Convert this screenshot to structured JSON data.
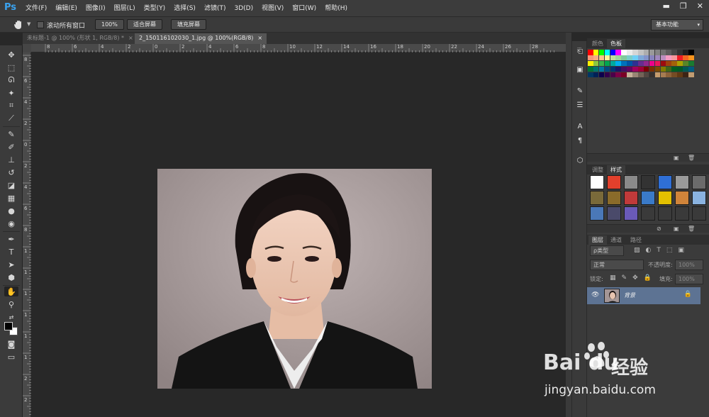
{
  "app": {
    "logo": "Ps"
  },
  "menu": [
    "文件(F)",
    "编辑(E)",
    "图像(I)",
    "图层(L)",
    "类型(Y)",
    "选择(S)",
    "滤镜(T)",
    "3D(D)",
    "视图(V)",
    "窗口(W)",
    "帮助(H)"
  ],
  "window_controls": {
    "minimize": "▬",
    "maximize": "❐",
    "close": "✕"
  },
  "options_bar": {
    "scroll_all_label": "滚动所有窗口",
    "btn_100": "100%",
    "btn_fit": "适合屏幕",
    "btn_fill": "填充屏幕",
    "workspace": "基本功能"
  },
  "tabs": [
    {
      "label": "未标题-1 @ 100% (形状 1, RGB/8) *",
      "close": "×"
    },
    {
      "label": "2_150116102030_1.jpg @ 100%(RGB/8)",
      "close": "×"
    }
  ],
  "ruler_top": [
    "8",
    "6",
    "4",
    "2",
    "0",
    "2",
    "4",
    "6",
    "8",
    "10",
    "12",
    "14",
    "16",
    "18",
    "20",
    "22",
    "24",
    "26",
    "28"
  ],
  "ruler_left": [
    "8",
    "6",
    "4",
    "2",
    "0",
    "2",
    "4",
    "6",
    "8",
    "1",
    "1",
    "1",
    "1",
    "1",
    "1",
    "2",
    "2"
  ],
  "panels": {
    "color_tabs": [
      "颜色",
      "色板"
    ],
    "adjust_tabs": [
      "调整",
      "样式"
    ],
    "layer_tabs": [
      "图层",
      "通道",
      "路径"
    ],
    "layer_filter": "ρ类型",
    "blend_mode": "正常",
    "opacity_label": "不透明度:",
    "opacity_value": "100%",
    "lock_label": "锁定:",
    "fill_label": "填充:",
    "fill_value": "100%",
    "layer_name": "背景"
  },
  "colors": {
    "swatches": [
      "#ff0000",
      "#ffff00",
      "#00ff00",
      "#00ffff",
      "#0000ff",
      "#ff00ff",
      "#ffffff",
      "#ebebeb",
      "#d6d6d6",
      "#c2c2c2",
      "#adadad",
      "#999999",
      "#858585",
      "#707070",
      "#5c5c5c",
      "#474747",
      "#333333",
      "#1f1f1f",
      "#000000",
      "#f7977a",
      "#f9ad81",
      "#fdc68a",
      "#fff79a",
      "#c4df9b",
      "#a3d39c",
      "#82ca9d",
      "#7bcdc8",
      "#6ecff6",
      "#7ea7d8",
      "#8493ca",
      "#8882be",
      "#a187be",
      "#bc8dbf",
      "#f49ac2",
      "#f6989d",
      "#ed1c24",
      "#f26522",
      "#f7941d",
      "#fff200",
      "#8dc73f",
      "#39b54a",
      "#00a651",
      "#00a99d",
      "#00aeef",
      "#0072bc",
      "#0054a6",
      "#2e3192",
      "#662d91",
      "#92278f",
      "#ec008c",
      "#ed145b",
      "#9e0b0f",
      "#a0410d",
      "#a3620a",
      "#aba000",
      "#598527",
      "#197b30",
      "#007236",
      "#00746b",
      "#0076a3",
      "#004a80",
      "#003471",
      "#1b1464",
      "#440e62",
      "#630460",
      "#9e005d",
      "#9e0039",
      "#790000",
      "#7b2e00",
      "#7d4900",
      "#827b00",
      "#406618",
      "#005e20",
      "#005826",
      "#005952",
      "#005b7f",
      "#003663",
      "#002157",
      "#0d004c",
      "#32004b",
      "#4b0049",
      "#7b0046",
      "#7a0026",
      "#c7b299",
      "#998675",
      "#736357",
      "#534741",
      "#37302d",
      "#c69c6d",
      "#a67c52",
      "#8c6239",
      "#754c24",
      "#603913",
      "#3c2415",
      "#c09c72"
    ],
    "styles": [
      "#ffffff",
      "#e2402c",
      "#8a8a8a",
      "#333333",
      "#2f6fd6",
      "#9a9a9a",
      "#6b6b6b",
      "#7a6a3a",
      "#8a6b2a",
      "#c03a3a",
      "#3a7ac8",
      "#e3c000",
      "#d0843a",
      "#8ab3e0",
      "#4a78b8",
      "#4a4a6a",
      "#6a5ab8",
      "#3a3a3a",
      "#3a3a3a",
      "#3a3a3a",
      "#3a3a3a"
    ]
  },
  "watermark": {
    "logo": "Bai du",
    "jingyan": "经验",
    "url": "jingyan.baidu.com"
  }
}
